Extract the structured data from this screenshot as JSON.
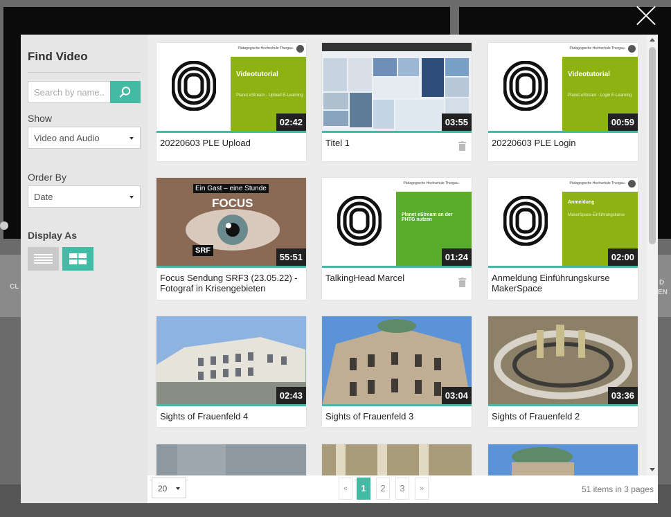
{
  "backdrop": {
    "frag_left": "CL",
    "frag_right_1": "D",
    "frag_right_2": "EN"
  },
  "modal": {
    "sidebar": {
      "title": "Find Video",
      "search_placeholder": "Search by name...",
      "show_label": "Show",
      "show_value": "Video and Audio",
      "order_label": "Order By",
      "order_value": "Date",
      "display_label": "Display As"
    },
    "videos": [
      {
        "title": "20220603 PLE Upload",
        "duration": "02:42",
        "thumb": "tutorial",
        "thumb_title": "Videotutorial",
        "thumb_sub": "Planet eStream - Upload E-Learning",
        "deletable": false
      },
      {
        "title": "Titel 1",
        "duration": "03:55",
        "thumb": "collage",
        "deletable": true
      },
      {
        "title": "20220603 PLE Login",
        "duration": "00:59",
        "thumb": "tutorial",
        "thumb_title": "Videotutorial",
        "thumb_sub": "Planet eStream - Login E-Learning",
        "deletable": false
      },
      {
        "title": "Focus Sendung SRF3 (23.05.22) - Fotograf in Krisengebieten",
        "duration": "55:51",
        "thumb": "eye",
        "thumb_tag": "Ein Gast – eine Stunde",
        "thumb_big": "FOCUS",
        "thumb_logo": "SRF",
        "deletable": false
      },
      {
        "title": "TalkingHead Marcel",
        "duration": "01:24",
        "thumb": "tutorial",
        "thumb_title": "Planet eStream an der PHTG nutzen",
        "thumb_sub": "",
        "deletable": true
      },
      {
        "title": "Anmeldung Einführungskurse MakerSpace",
        "duration": "02:00",
        "thumb": "tutorial",
        "thumb_title": "Anmeldung",
        "thumb_sub": "MakerSpace-Einführungskurse",
        "deletable": false
      },
      {
        "title": "Sights of Frauenfeld 4",
        "duration": "02:43",
        "thumb": "photo",
        "deletable": false
      },
      {
        "title": "Sights of Frauenfeld 3",
        "duration": "03:04",
        "thumb": "photo",
        "deletable": false
      },
      {
        "title": "Sights of Frauenfeld 2",
        "duration": "03:36",
        "thumb": "photo",
        "deletable": false
      }
    ],
    "thumb_header": "Pädagogische Hochschule Thurgau.",
    "footer": {
      "page_size": "20",
      "pages": [
        "1",
        "2",
        "3"
      ],
      "current_page": "1",
      "prev": "«",
      "next": "»",
      "summary": "51 items in 3 pages"
    }
  },
  "colors": {
    "accent": "#44b9a4",
    "tutorial_green": "#8db312"
  }
}
